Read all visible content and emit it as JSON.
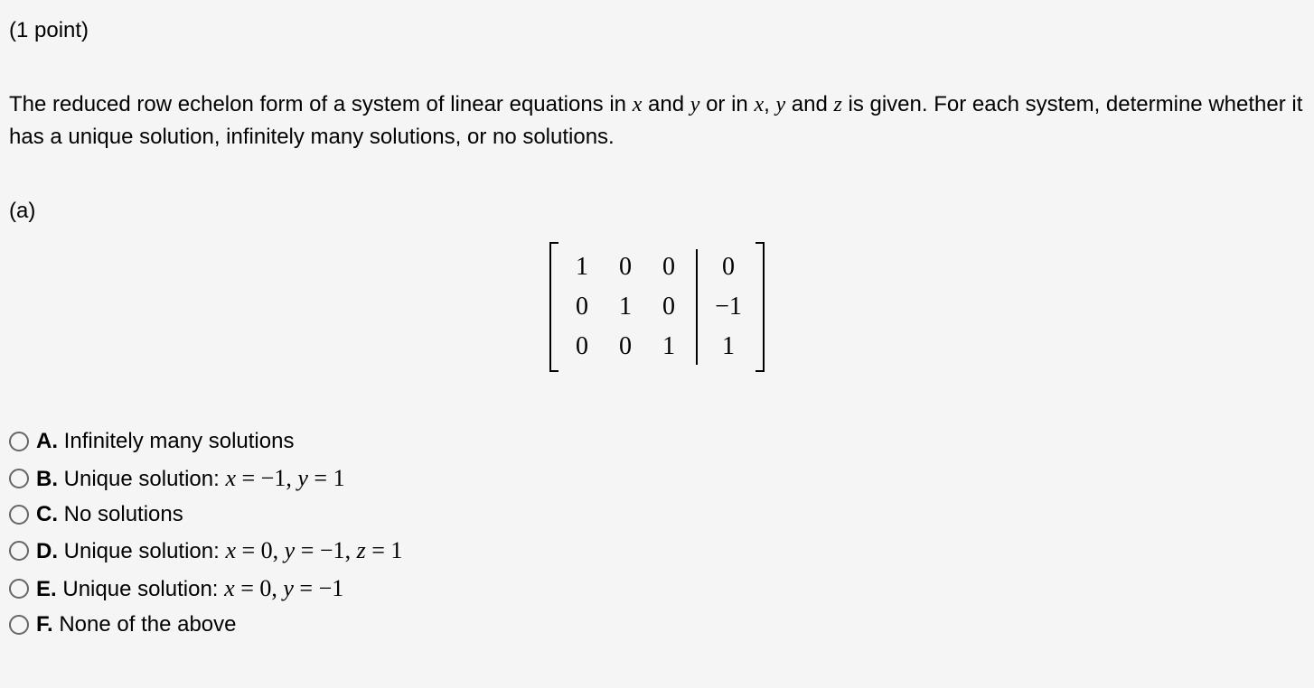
{
  "points_text": "(1 point)",
  "prompt_parts": {
    "p1": "The reduced row echelon form of a system of linear equations in ",
    "v1": "x",
    "p2": " and ",
    "v2": "y",
    "p3": " or in ",
    "v3": "x",
    "p4": ", ",
    "v4": "y",
    "p5": " and ",
    "v5": "z",
    "p6": " is given. For each system, determine whether it has a unique solution, infinitely many solutions, or no solutions."
  },
  "part_label": "(a)",
  "matrix": {
    "r0c0": "1",
    "r0c1": "0",
    "r0c2": "0",
    "r0c3": "0",
    "r1c0": "0",
    "r1c1": "1",
    "r1c2": "0",
    "r1c3": "−1",
    "r2c0": "0",
    "r2c1": "0",
    "r2c2": "1",
    "r2c3": "1"
  },
  "options": {
    "A": {
      "letter": "A.",
      "text": "Infinitely many solutions"
    },
    "B": {
      "letter": "B.",
      "lead": "Unique solution: ",
      "eq": {
        "x": "x",
        "eq1": " = ",
        "xv": "−1",
        "sep1": ", ",
        "y": "y",
        "eq2": " = ",
        "yv": "1"
      }
    },
    "C": {
      "letter": "C.",
      "text": "No solutions"
    },
    "D": {
      "letter": "D.",
      "lead": "Unique solution: ",
      "eq": {
        "x": "x",
        "eq1": " = ",
        "xv": "0",
        "sep1": ", ",
        "y": "y",
        "eq2": " = ",
        "yv": "−1",
        "sep2": ", ",
        "z": "z",
        "eq3": " = ",
        "zv": "1"
      }
    },
    "E": {
      "letter": "E.",
      "lead": "Unique solution: ",
      "eq": {
        "x": "x",
        "eq1": " = ",
        "xv": "0",
        "sep1": ", ",
        "y": "y",
        "eq2": " = ",
        "yv": "−1"
      }
    },
    "F": {
      "letter": "F.",
      "text": "None of the above"
    }
  }
}
